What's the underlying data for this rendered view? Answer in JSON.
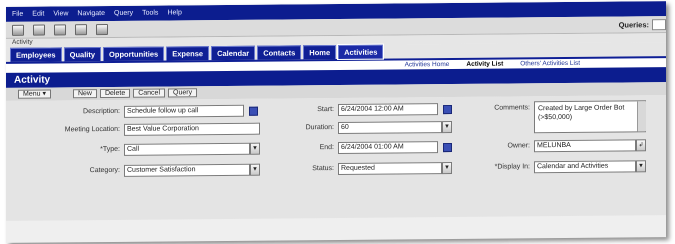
{
  "menu": [
    "File",
    "Edit",
    "View",
    "Navigate",
    "Query",
    "Tools",
    "Help"
  ],
  "toolbar": {
    "icons": [
      "print-icon",
      "new-record-icon",
      "copy-icon",
      "paste-icon",
      "delete-icon"
    ]
  },
  "queries": {
    "label": "Queries:",
    "value": ""
  },
  "breadcrumb": "Activity",
  "tabs": [
    "Employees",
    "Quality",
    "Opportunities",
    "Expense",
    "Calendar",
    "Contacts",
    "Home",
    "Activities"
  ],
  "active_tab": "Activities",
  "subnav": [
    "Activities Home",
    "Activity List",
    "Others' Activities List"
  ],
  "panel": {
    "title": "Activity",
    "buttons": {
      "menu": "Menu ▾",
      "new": "New",
      "delete": "Delete",
      "cancel": "Cancel",
      "query": "Query"
    }
  },
  "form": {
    "description": {
      "label": "Description:",
      "value": "Schedule follow up call"
    },
    "meeting_location": {
      "label": "Meeting Location:",
      "value": "Best Value Corporation"
    },
    "type": {
      "label": "*Type:",
      "value": "Call"
    },
    "category": {
      "label": "Category:",
      "value": "Customer Satisfaction"
    },
    "start": {
      "label": "Start:",
      "value": "6/24/2004 12:00 AM"
    },
    "duration": {
      "label": "Duration:",
      "value": "60"
    },
    "end": {
      "label": "End:",
      "value": "6/24/2004 01:00 AM"
    },
    "status": {
      "label": "Status:",
      "value": "Requested"
    },
    "comments": {
      "label": "Comments:",
      "value": "Created by Large Order Bot (>$50,000)"
    },
    "owner": {
      "label": "Owner:",
      "value": "MELUNBA"
    },
    "display_in": {
      "label": "*Display In:",
      "value": "Calendar and Activities"
    }
  }
}
